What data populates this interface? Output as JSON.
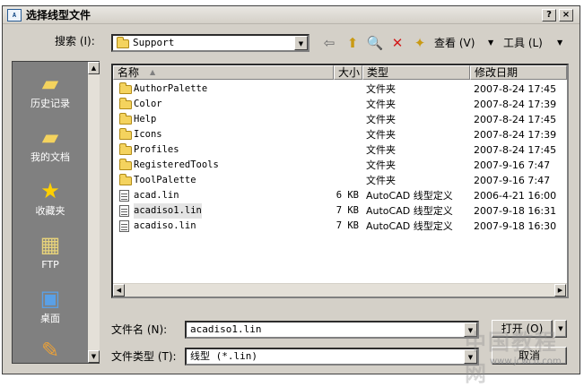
{
  "window": {
    "title": "选择线型文件"
  },
  "titlebar_buttons": {
    "help": "?",
    "close": "×"
  },
  "search": {
    "label": "搜索 (I):",
    "value": "Support"
  },
  "toolbar": {
    "view_label": "查看 (V)",
    "tools_label": "工具 (L)"
  },
  "places": [
    {
      "label": "历史记录",
      "icon": "history-folder-icon"
    },
    {
      "label": "我的文档",
      "icon": "my-documents-icon"
    },
    {
      "label": "收藏夹",
      "icon": "favorites-star-icon"
    },
    {
      "label": "FTP",
      "icon": "ftp-icon"
    },
    {
      "label": "桌面",
      "icon": "desktop-icon"
    }
  ],
  "columns": {
    "name": "名称",
    "size": "大小",
    "type": "类型",
    "modified": "修改日期"
  },
  "files": [
    {
      "name": "AuthorPalette",
      "size": "",
      "type": "文件夹",
      "modified": "2007-8-24 17:45",
      "kind": "folder"
    },
    {
      "name": "Color",
      "size": "",
      "type": "文件夹",
      "modified": "2007-8-24 17:39",
      "kind": "folder"
    },
    {
      "name": "Help",
      "size": "",
      "type": "文件夹",
      "modified": "2007-8-24 17:45",
      "kind": "folder"
    },
    {
      "name": "Icons",
      "size": "",
      "type": "文件夹",
      "modified": "2007-8-24 17:39",
      "kind": "folder"
    },
    {
      "name": "Profiles",
      "size": "",
      "type": "文件夹",
      "modified": "2007-8-24 17:45",
      "kind": "folder"
    },
    {
      "name": "RegisteredTools",
      "size": "",
      "type": "文件夹",
      "modified": "2007-9-16 7:47",
      "kind": "folder"
    },
    {
      "name": "ToolPalette",
      "size": "",
      "type": "文件夹",
      "modified": "2007-9-16 7:47",
      "kind": "folder"
    },
    {
      "name": "acad.lin",
      "size": "6 KB",
      "type": "AutoCAD 线型定义",
      "modified": "2006-4-21 16:00",
      "kind": "file"
    },
    {
      "name": "acadiso1.lin",
      "size": "7 KB",
      "type": "AutoCAD 线型定义",
      "modified": "2007-9-18 16:31",
      "kind": "file",
      "selected": true
    },
    {
      "name": "acadiso.lin",
      "size": "7 KB",
      "type": "AutoCAD 线型定义",
      "modified": "2007-9-18 16:30",
      "kind": "file"
    }
  ],
  "filename": {
    "label": "文件名 (N):",
    "value": "acadiso1.lin"
  },
  "filetype": {
    "label": "文件类型 (T):",
    "value": "线型 (*.lin)"
  },
  "buttons": {
    "open": "打开 (O)",
    "cancel": "取消"
  },
  "watermark": {
    "text": "中国教程网",
    "url": "www.jcwcn.com"
  }
}
